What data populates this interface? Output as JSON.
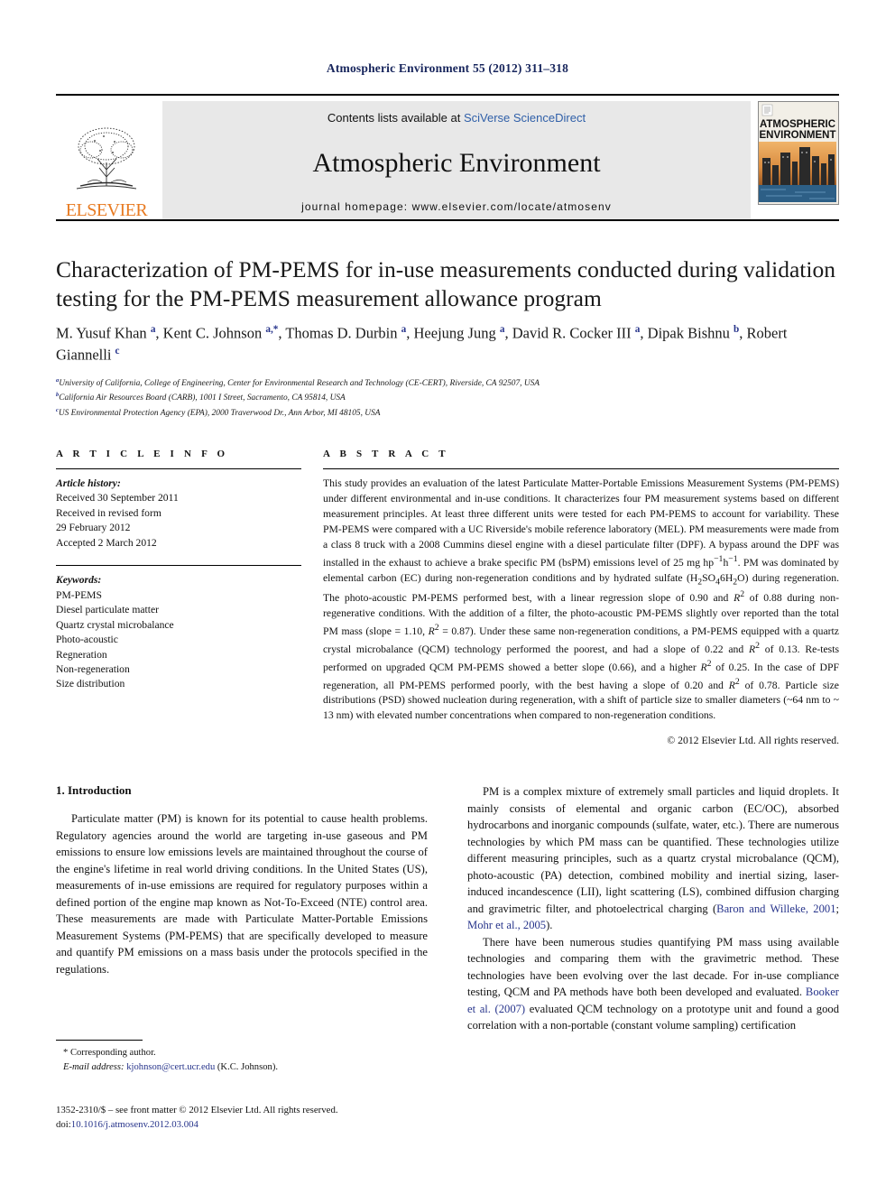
{
  "running_head": "Atmospheric Environment 55 (2012) 311–318",
  "masthead": {
    "publisher_logo_word": "ELSEVIER",
    "contents_prefix": "Contents lists available at ",
    "contents_link": "SciVerse ScienceDirect",
    "journal_name": "Atmospheric Environment",
    "homepage_line": "journal homepage: www.elsevier.com/locate/atmosenv",
    "cover_title_line1": "ATMOSPHERIC",
    "cover_title_line2": "ENVIRONMENT"
  },
  "article": {
    "title": "Characterization of PM-PEMS for in-use measurements conducted during validation testing for the PM-PEMS measurement allowance program",
    "authors_html": "M. Yusuf Khan <sup>a</sup>, Kent C. Johnson <sup>a,</sup><sup>*</sup>, Thomas D. Durbin <sup>a</sup>, Heejung Jung <sup>a</sup>, David R. Cocker III <sup>a</sup>, Dipak Bishnu <sup>b</sup>, Robert Giannelli <sup>c</sup>",
    "affiliations": [
      "University of California, College of Engineering, Center for Environmental Research and Technology (CE-CERT), Riverside, CA 92507, USA",
      "California Air Resources Board (CARB), 1001 I Street, Sacramento, CA 95814, USA",
      "US Environmental Protection Agency (EPA), 2000 Traverwood Dr., Ann Arbor, MI 48105, USA"
    ],
    "affiliation_marks": [
      "a",
      "b",
      "c"
    ]
  },
  "article_info": {
    "heading": "A R T I C L E  I N F O",
    "history_label": "Article history:",
    "history_lines": [
      "Received 30 September 2011",
      "Received in revised form",
      "29 February 2012",
      "Accepted 2 March 2012"
    ],
    "keywords_label": "Keywords:",
    "keywords": [
      "PM-PEMS",
      "Diesel particulate matter",
      "Quartz crystal microbalance",
      "Photo-acoustic",
      "Regneration",
      "Non-regeneration",
      "Size distribution"
    ]
  },
  "abstract": {
    "heading": "A B S T R A C T",
    "text_html": "This study provides an evaluation of the latest Particulate Matter-Portable Emissions Measurement Systems (PM-PEMS) under different environmental and in-use conditions. It characterizes four PM measurement systems based on different measurement principles. At least three different units were tested for each PM-PEMS to account for variability. These PM-PEMS were compared with a UC Riverside's mobile reference laboratory (MEL). PM measurements were made from a class 8 truck with a 2008 Cummins diesel engine with a diesel particulate filter (DPF). A bypass around the DPF was installed in the exhaust to achieve a brake specific PM (bsPM) emissions level of 25 mg hp<sup>&minus;1</sup>h<sup>&minus;1</sup>. PM was dominated by elemental carbon (EC) during non-regeneration conditions and by hydrated sulfate (H<sub>2</sub>SO<sub>4</sub>6H<sub>2</sub>O) during regeneration. The photo-acoustic PM-PEMS performed best, with a linear regression slope of 0.90 and <i>R</i><sup>2</sup> of 0.88 during non-regenerative conditions. With the addition of a filter, the photo-acoustic PM-PEMS slightly over reported than the total PM mass (slope = 1.10, <i>R</i><sup>2</sup> = 0.87). Under these same non-regeneration conditions, a PM-PEMS equipped with a quartz crystal microbalance (QCM) technology performed the poorest, and had a slope of 0.22 and <i>R</i><sup>2</sup> of 0.13. Re-tests performed on upgraded QCM PM-PEMS showed a better slope (0.66), and a higher <i>R</i><sup>2</sup> of 0.25. In the case of DPF regeneration, all PM-PEMS performed poorly, with the best having a slope of 0.20 and <i>R</i><sup>2</sup> of 0.78. Particle size distributions (PSD) showed nucleation during regeneration, with a shift of particle size to smaller diameters (&#126;64 nm to &#126; 13 nm) with elevated number concentrations when compared to non-regeneration conditions.",
    "copyright": "© 2012 Elsevier Ltd. All rights reserved."
  },
  "body": {
    "section_number_title": "1.  Introduction",
    "left_paragraphs_html": [
      "Particulate matter (PM) is known for its potential to cause health problems. Regulatory agencies around the world are targeting in-use gaseous and PM emissions to ensure low emissions levels are maintained throughout the course of the engine's lifetime in real world driving conditions. In the United States (US), measurements of in-use emissions are required for regulatory purposes within a defined portion of the engine map known as Not-To-Exceed (NTE) control area. These measurements are made with Particulate Matter-Portable Emissions Measurement Systems (PM-PEMS) that are specifically developed to measure and quantify PM emissions on a mass basis under the protocols specified in the regulations."
    ],
    "right_paragraphs_html": [
      "PM is a complex mixture of extremely small particles and liquid droplets. It mainly consists of elemental and organic carbon (EC/OC), absorbed hydrocarbons and inorganic compounds (sulfate, water, etc.). There are numerous technologies by which PM mass can be quantified. These technologies utilize different measuring principles, such as a quartz crystal microbalance (QCM), photo-acoustic (PA) detection, combined mobility and inertial sizing, laser-induced incandescence (LII), light scattering (LS), combined diffusion charging and gravimetric filter, and photoelectrical charging (<span class=\"ref-link\">Baron and Willeke, 2001</span>; <span class=\"ref-link\">Mohr et al., 2005</span>).",
      "There have been numerous studies quantifying PM mass using available technologies and comparing them with the gravimetric method. These technologies have been evolving over the last decade. For in-use compliance testing, QCM and PA methods have both been developed and evaluated. <span class=\"ref-link\">Booker et al. (2007)</span> evaluated QCM technology on a prototype unit and found a good correlation with a non-portable (constant volume sampling) certification"
    ]
  },
  "footnote": {
    "corresponding_author": "* Corresponding author.",
    "email_label": "E-mail address:",
    "email": "kjohnson@cert.ucr.edu",
    "email_suffix": "(K.C. Johnson)."
  },
  "footer": {
    "issn_line": "1352-2310/$ – see front matter © 2012 Elsevier Ltd. All rights reserved.",
    "doi_label": "doi:",
    "doi_value": "10.1016/j.atmosenv.2012.03.004"
  },
  "colors": {
    "link_blue": "#27348b",
    "sciencedirect_blue": "#2f5fa8",
    "elsevier_orange": "#e87b22",
    "running_head": "#17255c"
  }
}
